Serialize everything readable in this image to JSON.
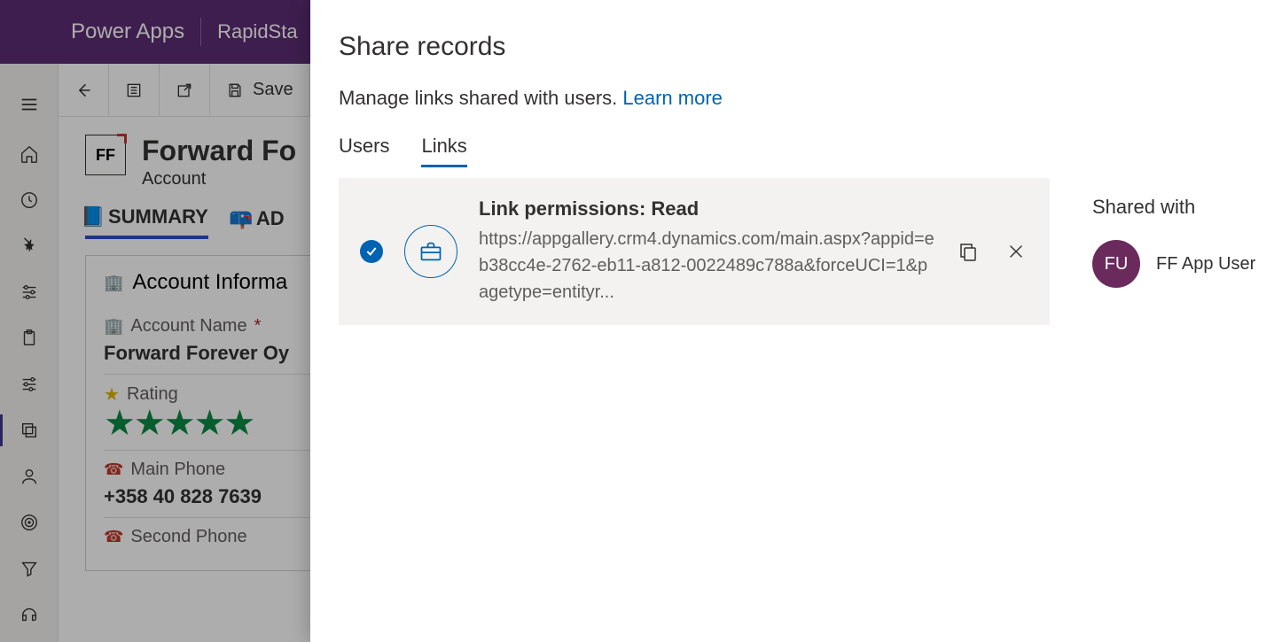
{
  "header": {
    "app_name": "Power Apps",
    "sub_app": "RapidSta"
  },
  "commands": {
    "save": "Save"
  },
  "record": {
    "logo_text": "FF",
    "title": "Forward Fo",
    "type": "Account"
  },
  "tabs": {
    "summary": "SUMMARY",
    "additional": "AD"
  },
  "form": {
    "section_title": "Account Informa",
    "account_name_label": "Account Name",
    "account_name_value": "Forward Forever Oy",
    "rating_label": "Rating",
    "rating_stars": "★★★★★",
    "main_phone_label": "Main Phone",
    "main_phone_value": "+358 40 828 7639",
    "second_phone_label": "Second Phone"
  },
  "panel": {
    "title": "Share records",
    "description": "Manage links shared with users.",
    "learn_more": "Learn more",
    "tabs": {
      "users": "Users",
      "links": "Links"
    },
    "link": {
      "permission_label": "Link permissions: Read",
      "url": "https://appgallery.crm4.dynamics.com/main.aspx?appid=eb38cc4e-2762-eb11-a812-0022489c788a&forceUCI=1&pagetype=entityr..."
    },
    "shared_with_title": "Shared with",
    "shared_user": {
      "initials": "FU",
      "name": "FF App User"
    }
  }
}
